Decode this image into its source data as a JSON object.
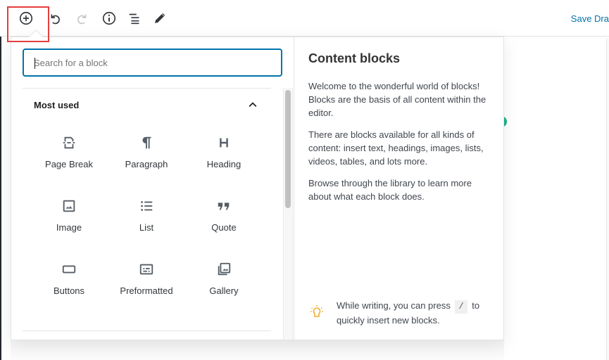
{
  "toolbar": {
    "buttons": [
      {
        "name": "inserter",
        "icon": "plus-circle-icon",
        "label": "Add block",
        "highlighted": true
      },
      {
        "name": "undo",
        "icon": "undo-icon",
        "label": "Undo",
        "enabled": true
      },
      {
        "name": "redo",
        "icon": "redo-icon",
        "label": "Redo",
        "enabled": false
      },
      {
        "name": "info",
        "icon": "info-icon",
        "label": "Content structure"
      },
      {
        "name": "outline",
        "icon": "list-view-icon",
        "label": "Block navigation"
      },
      {
        "name": "tools",
        "icon": "pencil-icon",
        "label": "Tools"
      }
    ],
    "save_draft_label": "Save Dra",
    "highlight_color": "#e53e3e"
  },
  "inserter": {
    "search": {
      "placeholder": "Search for a block",
      "value": ""
    },
    "panel": {
      "title": "Most used",
      "expanded": true
    },
    "blocks": [
      {
        "label": "Page Break",
        "icon": "page-break-icon"
      },
      {
        "label": "Paragraph",
        "icon": "paragraph-icon"
      },
      {
        "label": "Heading",
        "icon": "heading-icon"
      },
      {
        "label": "Image",
        "icon": "image-icon"
      },
      {
        "label": "List",
        "icon": "list-icon"
      },
      {
        "label": "Quote",
        "icon": "quote-icon"
      },
      {
        "label": "Buttons",
        "icon": "button-icon"
      },
      {
        "label": "Preformatted",
        "icon": "preformatted-icon"
      },
      {
        "label": "Gallery",
        "icon": "gallery-icon"
      }
    ]
  },
  "help": {
    "title": "Content blocks",
    "paragraphs": [
      "Welcome to the wonderful world of blocks! Blocks are the basis of all content within the editor.",
      "There are blocks available for all kinds of content: insert text, headings, images, lists, videos, tables, and lots more.",
      "Browse through the library to learn more about what each block does."
    ],
    "tip": {
      "before": "While writing, you can press",
      "key": "/",
      "after": "to quickly insert new blocks."
    }
  },
  "colors": {
    "accent": "#0073aa",
    "tip_icon": "#f0b849",
    "teal": "#1eb18a"
  }
}
